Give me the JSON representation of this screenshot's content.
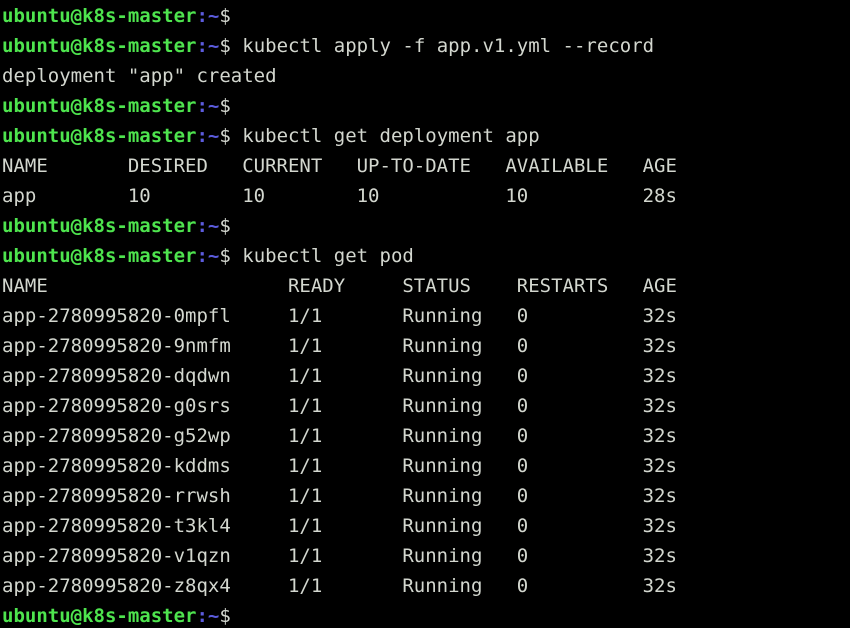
{
  "terminal": {
    "background_color": "#000000",
    "foreground_color": "#d3d7cf",
    "prompt_color": "#4ee44e",
    "punct_color": "#5c5cdd",
    "columns": 64,
    "rows": 21,
    "prompt": {
      "user_host": "ubuntu@k8s-master",
      "separator": ":",
      "path": "~",
      "sigil": "$"
    }
  },
  "lines": [
    {
      "type": "prompt",
      "command": ""
    },
    {
      "type": "prompt",
      "command": "kubectl apply -f app.v1.yml --record"
    },
    {
      "type": "output",
      "text": "deployment \"app\" created"
    },
    {
      "type": "prompt",
      "command": ""
    },
    {
      "type": "prompt",
      "command": "kubectl get deployment app"
    },
    {
      "type": "output",
      "text": "NAME       DESIRED   CURRENT   UP-TO-DATE   AVAILABLE   AGE"
    },
    {
      "type": "output",
      "text": "app        10        10        10           10          28s"
    },
    {
      "type": "prompt",
      "command": ""
    },
    {
      "type": "prompt",
      "command": "kubectl get pod"
    },
    {
      "type": "output",
      "text": "NAME                     READY     STATUS    RESTARTS   AGE"
    },
    {
      "type": "output",
      "text": "app-2780995820-0mpfl     1/1       Running   0          32s"
    },
    {
      "type": "output",
      "text": "app-2780995820-9nmfm     1/1       Running   0          32s"
    },
    {
      "type": "output",
      "text": "app-2780995820-dqdwn     1/1       Running   0          32s"
    },
    {
      "type": "output",
      "text": "app-2780995820-g0srs     1/1       Running   0          32s"
    },
    {
      "type": "output",
      "text": "app-2780995820-g52wp     1/1       Running   0          32s"
    },
    {
      "type": "output",
      "text": "app-2780995820-kddms     1/1       Running   0          32s"
    },
    {
      "type": "output",
      "text": "app-2780995820-rrwsh     1/1       Running   0          32s"
    },
    {
      "type": "output",
      "text": "app-2780995820-t3kl4     1/1       Running   0          32s"
    },
    {
      "type": "output",
      "text": "app-2780995820-v1qzn     1/1       Running   0          32s"
    },
    {
      "type": "output",
      "text": "app-2780995820-z8qx4     1/1       Running   0          32s"
    },
    {
      "type": "prompt",
      "command": ""
    }
  ],
  "commands": {
    "apply": "kubectl apply -f app.v1.yml --record",
    "get_deployment": "kubectl get deployment app",
    "get_pod": "kubectl get pod"
  },
  "deployment_table": {
    "headers": [
      "NAME",
      "DESIRED",
      "CURRENT",
      "UP-TO-DATE",
      "AVAILABLE",
      "AGE"
    ],
    "rows": [
      {
        "name": "app",
        "desired": "10",
        "current": "10",
        "up_to_date": "10",
        "available": "10",
        "age": "28s"
      }
    ]
  },
  "pod_table": {
    "headers": [
      "NAME",
      "READY",
      "STATUS",
      "RESTARTS",
      "AGE"
    ],
    "rows": [
      {
        "name": "app-2780995820-0mpfl",
        "ready": "1/1",
        "status": "Running",
        "restarts": "0",
        "age": "32s"
      },
      {
        "name": "app-2780995820-9nmfm",
        "ready": "1/1",
        "status": "Running",
        "restarts": "0",
        "age": "32s"
      },
      {
        "name": "app-2780995820-dqdwn",
        "ready": "1/1",
        "status": "Running",
        "restarts": "0",
        "age": "32s"
      },
      {
        "name": "app-2780995820-g0srs",
        "ready": "1/1",
        "status": "Running",
        "restarts": "0",
        "age": "32s"
      },
      {
        "name": "app-2780995820-g52wp",
        "ready": "1/1",
        "status": "Running",
        "restarts": "0",
        "age": "32s"
      },
      {
        "name": "app-2780995820-kddms",
        "ready": "1/1",
        "status": "Running",
        "restarts": "0",
        "age": "32s"
      },
      {
        "name": "app-2780995820-rrwsh",
        "ready": "1/1",
        "status": "Running",
        "restarts": "0",
        "age": "32s"
      },
      {
        "name": "app-2780995820-t3kl4",
        "ready": "1/1",
        "status": "Running",
        "restarts": "0",
        "age": "32s"
      },
      {
        "name": "app-2780995820-v1qzn",
        "ready": "1/1",
        "status": "Running",
        "restarts": "0",
        "age": "32s"
      },
      {
        "name": "app-2780995820-z8qx4",
        "ready": "1/1",
        "status": "Running",
        "restarts": "0",
        "age": "32s"
      }
    ]
  },
  "messages": {
    "deployment_created": "deployment \"app\" created"
  }
}
